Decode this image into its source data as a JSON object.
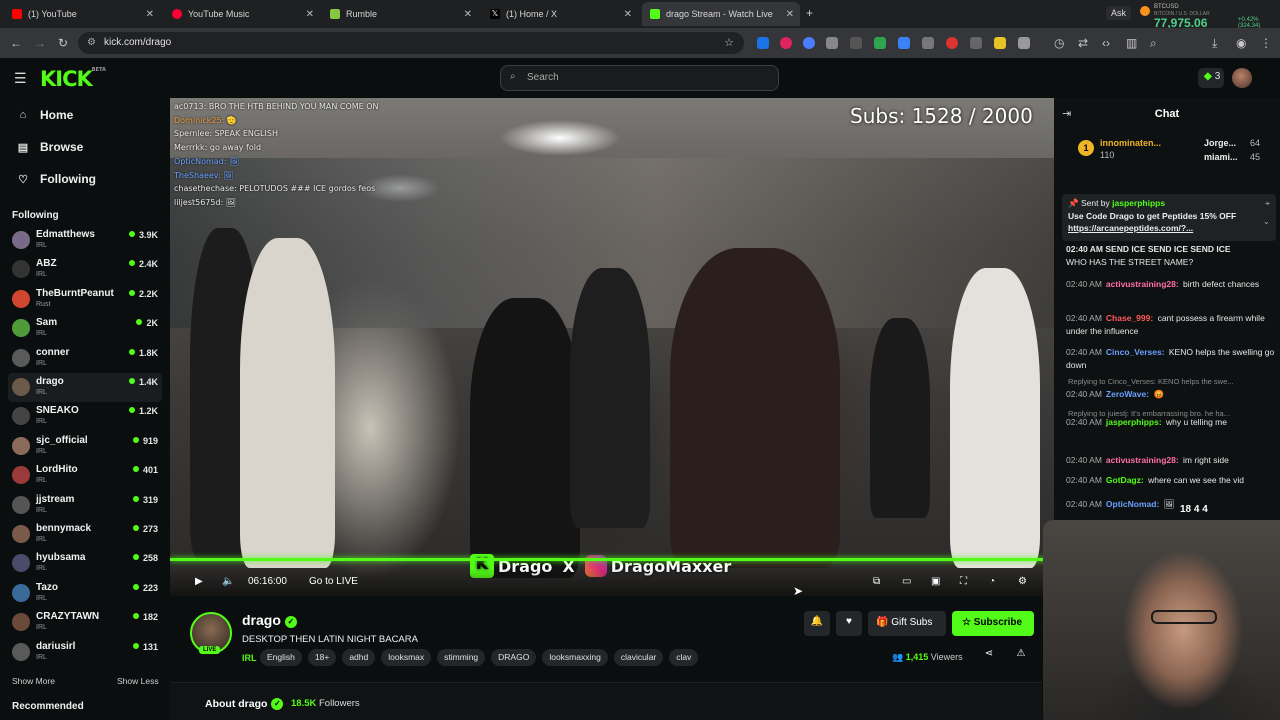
{
  "browser": {
    "tabs": [
      {
        "label": "(1) YouTube",
        "color": "#ff0000"
      },
      {
        "label": "YouTube Music",
        "color": "#ff0033"
      },
      {
        "label": "Rumble",
        "color": "#85c742"
      },
      {
        "label": "(1) Home / X",
        "color": "#000000"
      },
      {
        "label": "drago Stream - Watch Live",
        "color": "#53fc18"
      }
    ],
    "url": "kick.com/drago",
    "ticker": {
      "ask": "Ask",
      "symbol": "BTCUSD",
      "sub": "BITCOIN / U.S. DOLLAR",
      "price": "77,975.06",
      "change": "+0.42% (324.34)"
    }
  },
  "header": {
    "logo": "KICK",
    "logo_sup": "BETA",
    "search_placeholder": "Search",
    "kicks_count": "3"
  },
  "sidebar": {
    "nav": [
      {
        "label": "Home",
        "icon": "home-icon"
      },
      {
        "label": "Browse",
        "icon": "browse-icon"
      },
      {
        "label": "Following",
        "icon": "heart-icon"
      }
    ],
    "following_heading": "Following",
    "following": [
      {
        "name": "Edmatthews",
        "category": "IRL",
        "count": "3.9K",
        "color": "#7a6a8a"
      },
      {
        "name": "ABZ",
        "category": "IRL",
        "count": "2.4K",
        "color": "#333333"
      },
      {
        "name": "TheBurntPeanut",
        "category": "Rust",
        "count": "2.2K",
        "color": "#d0462e"
      },
      {
        "name": "Sam",
        "category": "IRL",
        "count": "2K",
        "color": "#4f9b3a"
      },
      {
        "name": "conner",
        "category": "IRL",
        "count": "1.8K",
        "color": "#5a5a5a"
      },
      {
        "name": "drago",
        "category": "IRL",
        "count": "1.4K",
        "color": "#6b5a4a"
      },
      {
        "name": "SNEAKO",
        "category": "IRL",
        "count": "1.2K",
        "color": "#444444"
      },
      {
        "name": "sjc_official",
        "category": "IRL",
        "count": "919",
        "color": "#8a6a5a"
      },
      {
        "name": "LordHito",
        "category": "IRL",
        "count": "401",
        "color": "#9a3a3a"
      },
      {
        "name": "jjstream",
        "category": "IRL",
        "count": "319",
        "color": "#555555"
      },
      {
        "name": "bennymack",
        "category": "IRL",
        "count": "273",
        "color": "#7a5a4a"
      },
      {
        "name": "hyubsama",
        "category": "IRL",
        "count": "258",
        "color": "#4a4a6a"
      },
      {
        "name": "Tazo",
        "category": "IRL",
        "count": "223",
        "color": "#3a6a9a"
      },
      {
        "name": "CRAZYTAWN",
        "category": "IRL",
        "count": "182",
        "color": "#6a4a3a"
      },
      {
        "name": "dariusirl",
        "category": "IRL",
        "count": "131",
        "color": "#5a5a5a"
      }
    ],
    "show_more": "Show More",
    "show_less": "Show Less",
    "recommended_heading": "Recommended"
  },
  "video": {
    "chat_overlay": [
      {
        "text": "ac0713: BRO THE HTB BEHIND YOU MAN COME ON",
        "color": "#e8e8e8"
      },
      {
        "text": "Dominick25: 🫡",
        "color": "#f0a040"
      },
      {
        "text": "Spernlee: SPEAK ENGLISH",
        "color": "#e8e8e8"
      },
      {
        "text": "Merrrkk: go away fold",
        "color": "#e8e8e8"
      },
      {
        "text": "OpticNomad: 🖼",
        "color": "#6aa0ff"
      },
      {
        "text": "TheShaeev: 🖼",
        "color": "#6aa0ff"
      },
      {
        "text": "chasethechase: PELOTUDOS ###  ICE gordos feos",
        "color": "#e8e8e8"
      },
      {
        "text": "liljest5675d: 🖼",
        "color": "#e8e8e8"
      }
    ],
    "subs_goal": "Subs: 1528 / 2000",
    "banner_left": "Drago",
    "banner_x": "X",
    "banner_right": "DragoMaxxer",
    "time": "06:16:00",
    "go_live": "Go to LIVE"
  },
  "channel": {
    "name": "drago",
    "live_badge": "LIVE",
    "title": "DESKTOP THEN LATIN NIGHT BACARA",
    "category": "IRL",
    "tags": [
      "English",
      "18+",
      "adhd",
      "looksmax",
      "stimming",
      "DRAGO",
      "looksmaxxing",
      "clavicular",
      "clav"
    ],
    "gift_label": "Gift Subs",
    "subscribe_label": "Subscribe",
    "viewers_count": "1,415",
    "viewers_label": "Viewers",
    "about_label": "About drago",
    "followers_count": "18.5K",
    "followers_label": "Followers"
  },
  "chat": {
    "title": "Chat",
    "leaders": [
      {
        "name": "innominaten...",
        "value": "110"
      },
      {
        "name": "Jorge...",
        "value": "64"
      },
      {
        "name": "miami...",
        "value": "45"
      }
    ],
    "pinned_by": "Sent by",
    "pinned_user": "jasperphipps",
    "pinned_text": "Use Code Drago to get Peptides 15% OFF",
    "pinned_link": "https://arcanepeptides.com/?...",
    "partial_top": "02:40 AM  SEND ICE  SEND ICE  SEND ICE",
    "messages": [
      {
        "time": "",
        "user": "",
        "user_color": "#e6e6e6",
        "text": "WHO HAS THE STREET NAME?"
      },
      {
        "time": "02:40 AM",
        "user": "activustraining28:",
        "user_color": "#ff6fa8",
        "text": "birth defect chances"
      },
      {
        "time": "02:40 AM",
        "user": "Chase_999:",
        "user_color": "#ff5a5a",
        "text": "cant possess a firearm while under the influence"
      },
      {
        "time": "02:40 AM",
        "user": "Cinco_Verses:",
        "user_color": "#6aa0ff",
        "text": "KENO helps the swelling go down"
      },
      {
        "time": "02:40 AM",
        "user": "ZeroWave:",
        "user_color": "#6aa0ff",
        "text": "😡"
      },
      {
        "time": "02:40 AM",
        "user": "jasperphipps:",
        "user_color": "#53fc18",
        "text": "why u telling me"
      },
      {
        "time": "02:40 AM",
        "user": "activustraining28:",
        "user_color": "#ff6fa8",
        "text": "im right side"
      },
      {
        "time": "02:40 AM",
        "user": "GotDagz:",
        "user_color": "#53fc18",
        "text": "where can we see the vid"
      },
      {
        "time": "02:40 AM",
        "user": "OpticNomad:",
        "user_color": "#6aa0ff",
        "text": "🖼"
      }
    ],
    "replies": [
      "Replying to Cinco_Verses: KENO helps the swe...",
      "Replying to juiestj: It's embarrassing bro. he ha..."
    ],
    "emote_counts": "18   4   4"
  }
}
